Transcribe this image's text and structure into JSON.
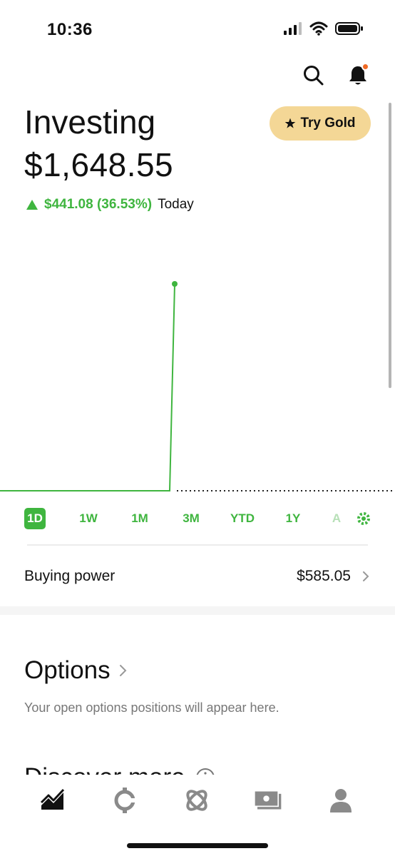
{
  "status_bar": {
    "time": "10:36"
  },
  "header": {
    "title": "Investing",
    "try_gold_label": "Try Gold",
    "portfolio_value": "$1,648.55",
    "change_amount": "$441.08 (36.53%)",
    "change_period": "Today"
  },
  "chart_data": {
    "type": "line",
    "title": "",
    "series": [
      {
        "values": [
          1207.47,
          1207.47,
          1207.47,
          1207.47,
          1207.47,
          1648.55
        ]
      }
    ],
    "baseline": 1207.47,
    "color": "#3fb53f",
    "grid": false
  },
  "range_tabs": [
    "1D",
    "1W",
    "1M",
    "3M",
    "YTD",
    "1Y",
    "A"
  ],
  "range_selected": "1D",
  "buying_power": {
    "label": "Buying power",
    "value": "$585.05"
  },
  "options": {
    "title": "Options",
    "subtitle": "Your open options positions will appear here."
  },
  "discover": {
    "title": "Discover more"
  },
  "tab_bar": {
    "items": [
      "investing-icon",
      "crypto-icon",
      "browse-icon",
      "cash-icon",
      "account-icon"
    ]
  },
  "colors": {
    "accent": "#3fb53f",
    "gold": "#f4d796",
    "notification": "#f06a25"
  }
}
